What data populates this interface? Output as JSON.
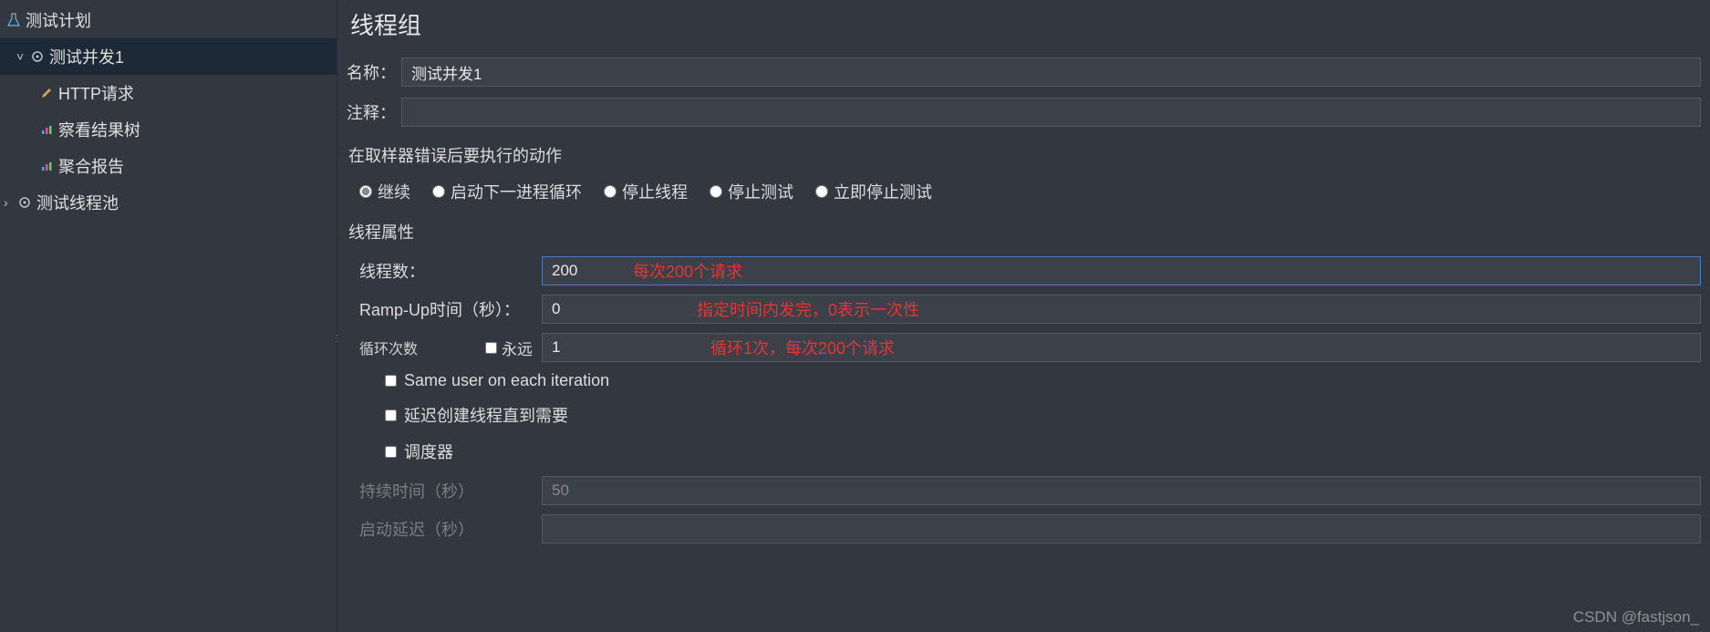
{
  "tree": {
    "root": {
      "label": "测试计划",
      "icon": "flask"
    },
    "items": [
      {
        "label": "测试并发1",
        "icon": "gear",
        "caret": "˅",
        "selected": true
      },
      {
        "label": "HTTP请求",
        "icon": "pencil",
        "indent": 2
      },
      {
        "label": "察看结果树",
        "icon": "chart",
        "indent": 2
      },
      {
        "label": "聚合报告",
        "icon": "chart",
        "indent": 2
      },
      {
        "label": "测试线程池",
        "icon": "gear",
        "caret": "›",
        "selected": false
      }
    ]
  },
  "header": {
    "title": "线程组"
  },
  "fields": {
    "name_label": "名称：",
    "name_value": "测试并发1",
    "comment_label": "注释：",
    "comment_value": ""
  },
  "error_action": {
    "group_label": "在取样器错误后要执行的动作",
    "options": [
      "继续",
      "启动下一进程循环",
      "停止线程",
      "停止测试",
      "立即停止测试"
    ],
    "selected_index": 0
  },
  "thread_props": {
    "group_label": "线程属性",
    "threads_label": "线程数：",
    "threads_value": "200",
    "threads_annotation": "每次200个请求",
    "rampup_label": "Ramp-Up时间（秒）：",
    "rampup_value": "0",
    "rampup_annotation": "指定时间内发完，0表示一次性",
    "loops_label": "循环次数",
    "forever_label": "永远",
    "loops_value": "1",
    "loops_annotation": "循环1次，每次200个请求",
    "same_user_label": "Same user on each iteration",
    "delay_create_label": "延迟创建线程直到需要",
    "scheduler_label": "调度器",
    "duration_label": "持续时间（秒）",
    "duration_value": "50",
    "startup_delay_label": "启动延迟（秒）",
    "startup_delay_value": ""
  },
  "watermark": "CSDN @fastjson_"
}
